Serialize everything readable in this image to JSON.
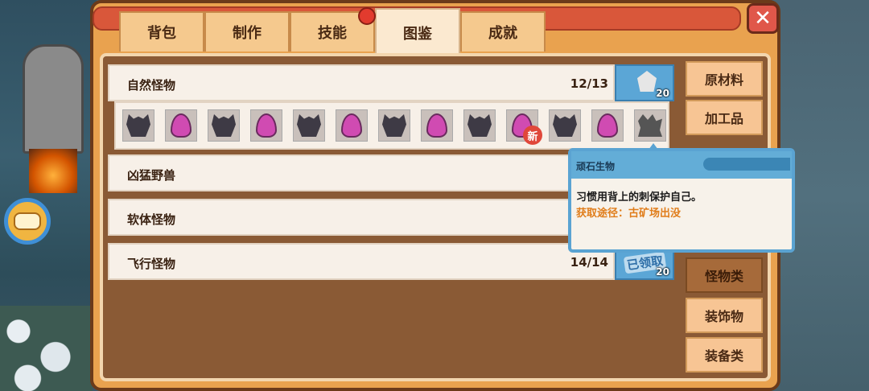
{
  "tabs": [
    "背包",
    "制作",
    "技能",
    "图鉴",
    "成就"
  ],
  "active_tab": "图鉴",
  "close_label": "✕",
  "categories": [
    {
      "name": "自然怪物",
      "count": "12/13",
      "reward": "20"
    },
    {
      "name": "凶猛野兽"
    },
    {
      "name": "软体怪物"
    },
    {
      "name": "飞行怪物",
      "count": "14/14",
      "reward": "20",
      "claimed": "已领取"
    }
  ],
  "monsters": [
    "rock-golem",
    "pink-slime",
    "rock-golem",
    "pink-slime",
    "rock-golem",
    "pink-slime",
    "rock-golem",
    "pink-slime",
    "rock-golem",
    "pink-slime",
    "rock-golem",
    "pink-slime",
    "unknown-shadow"
  ],
  "new_badge": "新",
  "sidebar": [
    "原材料",
    "加工品",
    "怪物类",
    "装饰物",
    "装备类"
  ],
  "active_sidebar": "怪物类",
  "tooltip": {
    "title": "顽石生物",
    "description": "习惯用背上的刺保护自己。",
    "source": "获取途径：古矿场出没"
  },
  "colors": {
    "panel": "#e9a24f",
    "accent_blue": "#5ba6d6",
    "tooltip_source": "#e07d1a"
  }
}
